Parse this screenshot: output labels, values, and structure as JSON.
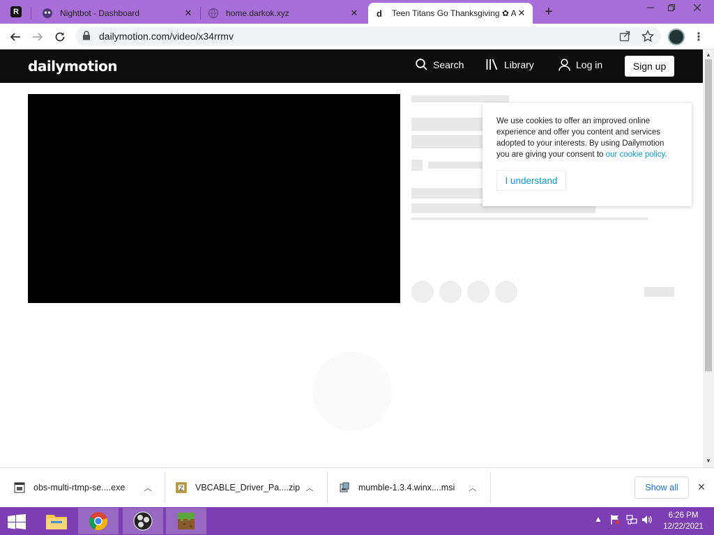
{
  "browser": {
    "tabs": [
      {
        "title": "Nightbot - Dashboard",
        "active": false
      },
      {
        "title": "home.darkok.xyz",
        "active": false
      },
      {
        "title": "Teen Titans Go Thanksgiving ✿ A",
        "active": true
      }
    ],
    "first_tab_letter": "R",
    "active_tab_favicon": "d",
    "url": "dailymotion.com/video/x34rrmv",
    "tab_strip_color": "#a96fd9"
  },
  "site": {
    "logo": "dailymotion",
    "nav": {
      "search": "Search",
      "library": "Library",
      "login": "Log in",
      "signup": "Sign up"
    }
  },
  "cookie_banner": {
    "text": "We use cookies to offer an improved online experience and offer you content and services adopted to your interests. By using Dailymotion you are giving your consent to",
    "link": "our cookie policy.",
    "button": "I understand",
    "accent": "#0a9ad6"
  },
  "downloads": {
    "items": [
      {
        "name": "obs-multi-rtmp-se....exe"
      },
      {
        "name": "VBCABLE_Driver_Pa....zip"
      },
      {
        "name": "mumble-1.3.4.winx....msi"
      }
    ],
    "show_all": "Show all"
  },
  "taskbar": {
    "time": "6:26 PM",
    "date": "12/22/2021",
    "color": "#7b3fb3"
  }
}
